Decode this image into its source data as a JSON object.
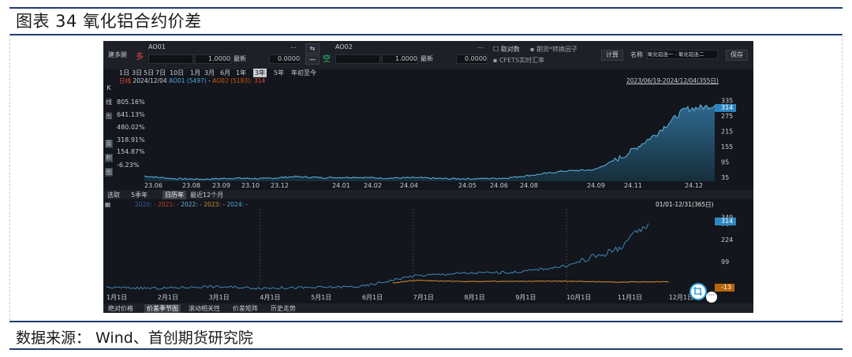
{
  "figure": {
    "title": "图表 34 氧化铝合约价差",
    "source": "数据来源：  Wind、首创期货研究院"
  },
  "toolbar": {
    "mode_label": "建多腿",
    "long_label": "多",
    "leg1_code": "AO01",
    "leg1_qty": "1.0000",
    "leg1_op": "最新",
    "leg1_offset": "0.0000",
    "leg2_code": "AO02",
    "leg2_qty": "1.0000",
    "leg2_op": "最新",
    "leg2_offset": "0.0000",
    "short_label": "空",
    "chk_log": "取对数",
    "chk_factor": "期货*转换因子",
    "chk_fx": "CFETS实时汇率",
    "calc_btn": "计算",
    "name_label": "名称",
    "name_value": "氧化铝连一 - 氧化铝连二",
    "save_btn": "保存",
    "ellipsis": "..."
  },
  "periods": [
    "1日",
    "3日",
    "5日",
    "7日",
    "10日",
    "1月",
    "3月",
    "6月",
    "1年",
    "3年",
    "5年",
    "年初至今"
  ],
  "selected_period": "3年",
  "top_pane": {
    "legend_prefix": "日线",
    "legend_date": "2024/12/04",
    "legend_ao01": "AO01 (5497)",
    "legend_ao02": "AO02 (5183)",
    "legend_spread": ": 314",
    "range_label": "2023/06/19-2024/12/04(355日)",
    "side_labels": [
      "K",
      "线",
      "图",
      "面",
      "积",
      "图"
    ],
    "left_ticks": [
      "805.16%",
      "641.13%",
      "480.02%",
      "318.91%",
      "154.87%",
      "-6.23%"
    ],
    "right_ticks": [
      "335",
      "275",
      "215",
      "155",
      "95",
      "35"
    ],
    "current_badge": "314"
  },
  "bottom_pane": {
    "tab_labels": [
      "选取",
      "5季年",
      "日历年",
      "最近12个月"
    ],
    "active_tab": "日历年",
    "legend": [
      "2020: -",
      "2021: -",
      "2022: -",
      "2023: -",
      "2024: -"
    ],
    "legend_colors": [
      "#3a5f9e",
      "#c0392b",
      "#6fa8d6",
      "#d48a2e",
      "#4aa8d8"
    ],
    "range_label": "01/01-12/31(365日)",
    "right_ticks": [
      "349",
      "314",
      "224",
      "99"
    ],
    "badge_2024": "314",
    "badge_2023": "-13",
    "sub_tabs": [
      "绝对价格",
      "价差季节图",
      "滚动相关性",
      "价差矩阵",
      "历史走势"
    ],
    "active_sub_tab": "价差季节图"
  },
  "chart_data": [
    {
      "type": "area",
      "title": "",
      "x_tick_labels": [
        "23.06",
        "23.08",
        "23.09",
        "23.10",
        "23.12",
        "24.01",
        "24.02",
        "24.04",
        "24.05",
        "24.06",
        "24.08",
        "24.09",
        "24.11",
        "24.12"
      ],
      "x": [
        "2023-06",
        "2023-07",
        "2023-08",
        "2023-09",
        "2023-10",
        "2023-11",
        "2023-12",
        "2024-01",
        "2024-02",
        "2024-03",
        "2024-04",
        "2024-05",
        "2024-06",
        "2024-07",
        "2024-08",
        "2024-09",
        "2024-10",
        "2024-11",
        "2024-11-20",
        "2024-12-04"
      ],
      "series": [
        {
          "name": "AO01 - AO02",
          "values": [
            40,
            30,
            28,
            32,
            30,
            38,
            34,
            36,
            32,
            34,
            30,
            30,
            32,
            45,
            60,
            65,
            120,
            200,
            300,
            314
          ]
        }
      ],
      "ylim": [
        20,
        345
      ]
    },
    {
      "type": "line",
      "title": "",
      "x_tick_labels": [
        "1月1日",
        "2月1日",
        "3月1日",
        "4月1日",
        "5月1日",
        "6月1日",
        "7月1日",
        "8月1日",
        "9月1日",
        "10月1日",
        "11月1日",
        "12月1日"
      ],
      "series": [
        {
          "name": "2023",
          "x": [
            1,
            2,
            3,
            4,
            5,
            6,
            7,
            8,
            9,
            10,
            11,
            12
          ],
          "values": [
            -45,
            -48,
            -47,
            -50,
            -48,
            -45,
            -5,
            -12,
            -10,
            -10,
            -15,
            -13
          ]
        },
        {
          "name": "2024",
          "x": [
            1,
            2,
            3,
            4,
            5,
            6,
            7,
            8,
            9,
            10,
            11,
            11.6
          ],
          "values": [
            -45,
            -50,
            -40,
            -48,
            -46,
            -40,
            20,
            35,
            40,
            75,
            170,
            314
          ]
        }
      ],
      "ylim": [
        -55,
        360
      ]
    }
  ]
}
